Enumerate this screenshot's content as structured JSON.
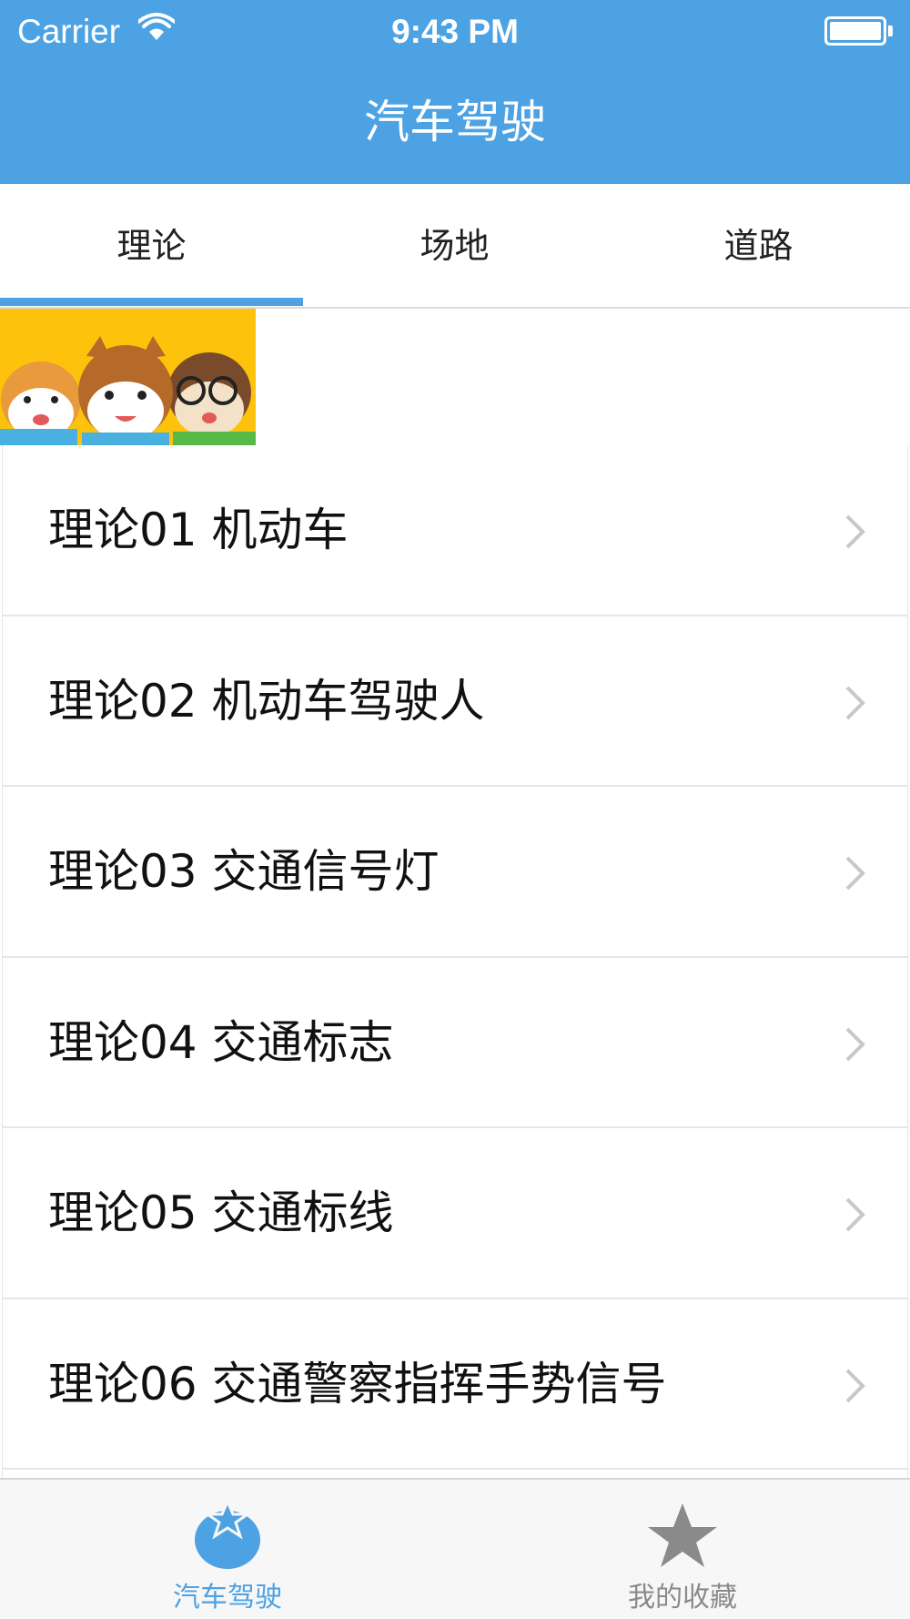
{
  "status_bar": {
    "carrier": "Carrier",
    "time": "9:43 PM"
  },
  "nav": {
    "title": "汽车驾驶"
  },
  "tabs": [
    {
      "label": "理论",
      "selected": true
    },
    {
      "label": "场地",
      "selected": false
    },
    {
      "label": "道路",
      "selected": false
    }
  ],
  "list": {
    "items": [
      {
        "label": "理论01 机动车"
      },
      {
        "label": "理论02 机动车驾驶人"
      },
      {
        "label": "理论03 交通信号灯"
      },
      {
        "label": "理论04 交通标志"
      },
      {
        "label": "理论05 交通标线"
      },
      {
        "label": "理论06 交通警察指挥手势信号"
      }
    ]
  },
  "tabbar": {
    "items": [
      {
        "label": "汽车驾驶",
        "icon": "tomato-icon",
        "active": true
      },
      {
        "label": "我的收藏",
        "icon": "star-icon",
        "active": false
      }
    ]
  },
  "colors": {
    "accent": "#4da2e3",
    "banner_bg": "#fdc20b",
    "inactive_tab": "#8a8a8a"
  }
}
